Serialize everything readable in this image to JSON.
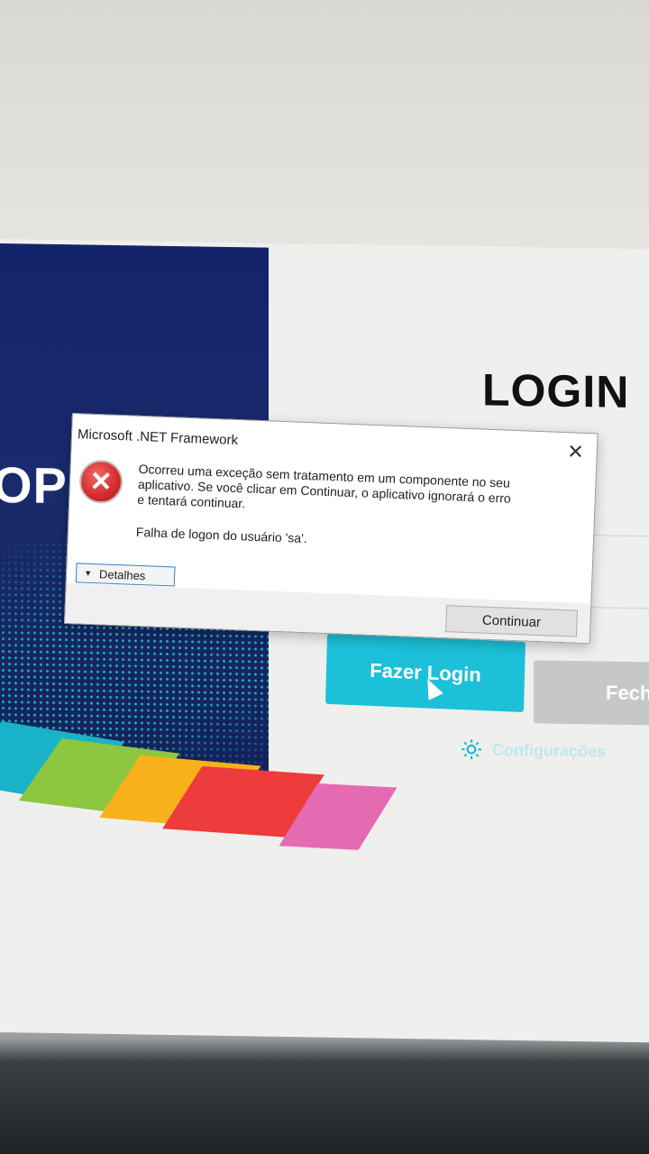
{
  "login": {
    "title": "LOGIN",
    "login_button": "Fazer Login",
    "close_button": "Fech",
    "settings_label": "Configurações",
    "logo_partial": "OP"
  },
  "dialog": {
    "title": "Microsoft .NET Framework",
    "close_glyph": "✕",
    "icon": "error-icon",
    "message": "Ocorreu uma exceção sem tratamento em um componente no seu aplicativo. Se você clicar em Continuar, o aplicativo ignorará o erro e tentará continuar.",
    "detail_message": "Falha de logon do usuário 'sa'.",
    "details_label": "Detalhes",
    "continue_label": "Continuar"
  },
  "colors": {
    "brand_navy": "#14246a",
    "login_accent": "#1cc0d8",
    "error_red": "#d42a2a"
  }
}
